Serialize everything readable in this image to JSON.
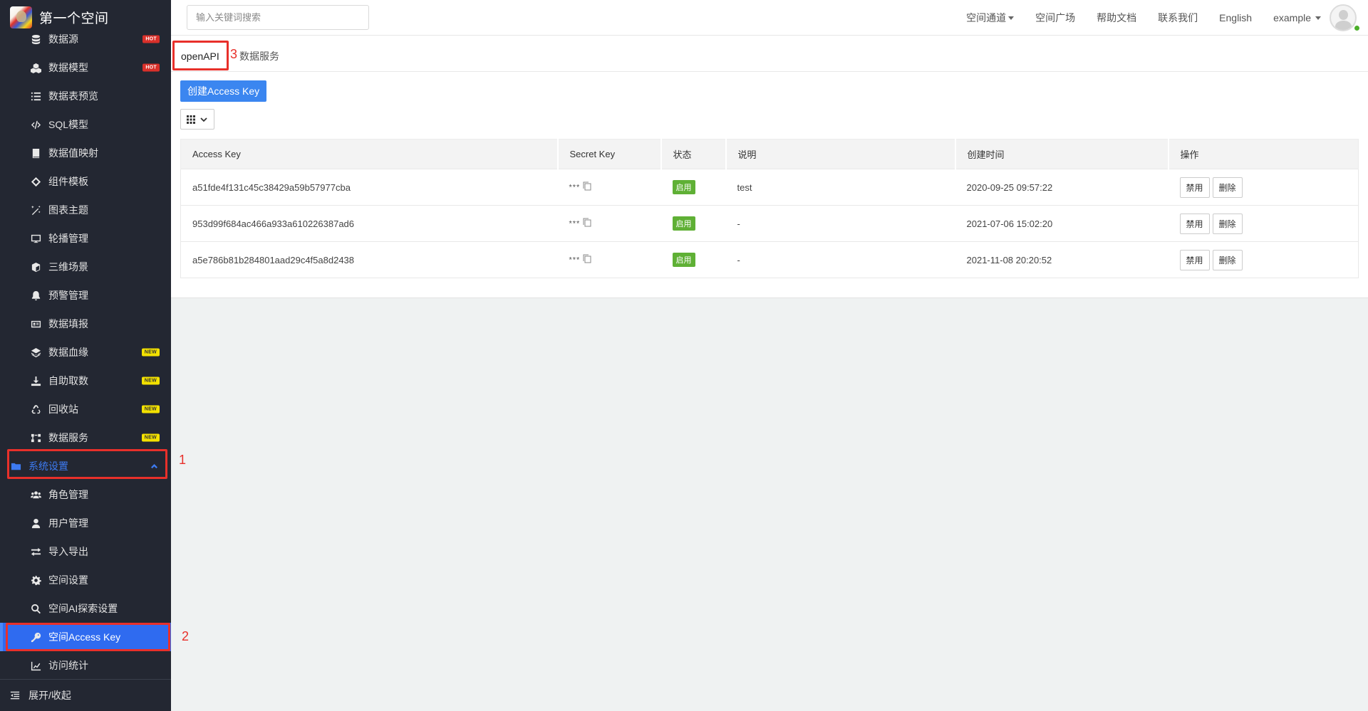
{
  "sidebar": {
    "brand_title": "第一个空间",
    "items": [
      {
        "label": "数据源",
        "icon": "database-icon",
        "badge": "HOT"
      },
      {
        "label": "数据模型",
        "icon": "cubes-icon",
        "badge": "HOT"
      },
      {
        "label": "数据表预览",
        "icon": "list-icon",
        "badge": ""
      },
      {
        "label": "SQL模型",
        "icon": "code-icon",
        "badge": ""
      },
      {
        "label": "数据值映射",
        "icon": "book-icon",
        "badge": ""
      },
      {
        "label": "组件模板",
        "icon": "component-icon",
        "badge": ""
      },
      {
        "label": "图表主题",
        "icon": "magic-wand-icon",
        "badge": ""
      },
      {
        "label": "轮播管理",
        "icon": "monitor-icon",
        "badge": ""
      },
      {
        "label": "三维场景",
        "icon": "cube-icon",
        "badge": ""
      },
      {
        "label": "预警管理",
        "icon": "bell-icon",
        "badge": ""
      },
      {
        "label": "数据填报",
        "icon": "id-card-icon",
        "badge": ""
      },
      {
        "label": "数据血缘",
        "icon": "layers-icon",
        "badge": "NEW"
      },
      {
        "label": "自助取数",
        "icon": "download-icon",
        "badge": "NEW"
      },
      {
        "label": "回收站",
        "icon": "recycle-icon",
        "badge": "NEW"
      },
      {
        "label": "数据服务",
        "icon": "network-icon",
        "badge": "NEW"
      }
    ],
    "group": {
      "label": "系统设置",
      "icon": "folder-icon",
      "expanded": true
    },
    "sub_items": [
      {
        "label": "角色管理",
        "icon": "users-icon",
        "active": false
      },
      {
        "label": "用户管理",
        "icon": "user-icon",
        "active": false
      },
      {
        "label": "导入导出",
        "icon": "exchange-icon",
        "active": false
      },
      {
        "label": "空间设置",
        "icon": "gear-icon",
        "active": false
      },
      {
        "label": "空间AI探索设置",
        "icon": "search-icon",
        "active": false
      },
      {
        "label": "空间Access Key",
        "icon": "key-icon",
        "active": true
      },
      {
        "label": "访问统计",
        "icon": "chart-line-icon",
        "active": false
      }
    ],
    "footer_label": "展开/收起"
  },
  "annotations": {
    "one": "1",
    "two": "2",
    "three": "3"
  },
  "header": {
    "search_placeholder": "输入关键词搜索",
    "nav": [
      {
        "label": "空间通道",
        "dropdown": true
      },
      {
        "label": "空间广场",
        "dropdown": false
      },
      {
        "label": "帮助文档",
        "dropdown": false
      },
      {
        "label": "联系我们",
        "dropdown": false
      },
      {
        "label": "English",
        "dropdown": false
      },
      {
        "label": "example",
        "dropdown": true
      }
    ],
    "user_status": "online"
  },
  "main": {
    "tabs": [
      {
        "label": "openAPI",
        "active": true
      },
      {
        "label": "数据服务",
        "active": false
      }
    ],
    "create_button": "创建Access Key",
    "table": {
      "columns": [
        "Access Key",
        "Secret Key",
        "状态",
        "说明",
        "创建时间",
        "操作"
      ],
      "rows": [
        {
          "access_key": "a51fde4f131c45c38429a59b57977cba",
          "secret_key": "***",
          "status": "启用",
          "description": "test",
          "created": "2020-09-25 09:57:22",
          "actions": [
            "禁用",
            "删除"
          ]
        },
        {
          "access_key": "953d99f684ac466a933a610226387ad6",
          "secret_key": "***",
          "status": "启用",
          "description": "-",
          "created": "2021-07-06 15:02:20",
          "actions": [
            "禁用",
            "删除"
          ]
        },
        {
          "access_key": "a5e786b81b284801aad29c4f5a8d2438",
          "secret_key": "***",
          "status": "启用",
          "description": "-",
          "created": "2021-11-08 20:20:52",
          "actions": [
            "禁用",
            "删除"
          ]
        }
      ]
    }
  },
  "colors": {
    "sidebar_bg": "#232732",
    "active": "#2f6bf0",
    "primary_button": "#3b86f0",
    "status_enabled": "#5fb035",
    "annotation": "#e8302a",
    "hot_badge": "#d9302a",
    "new_badge": "#f3e100"
  }
}
